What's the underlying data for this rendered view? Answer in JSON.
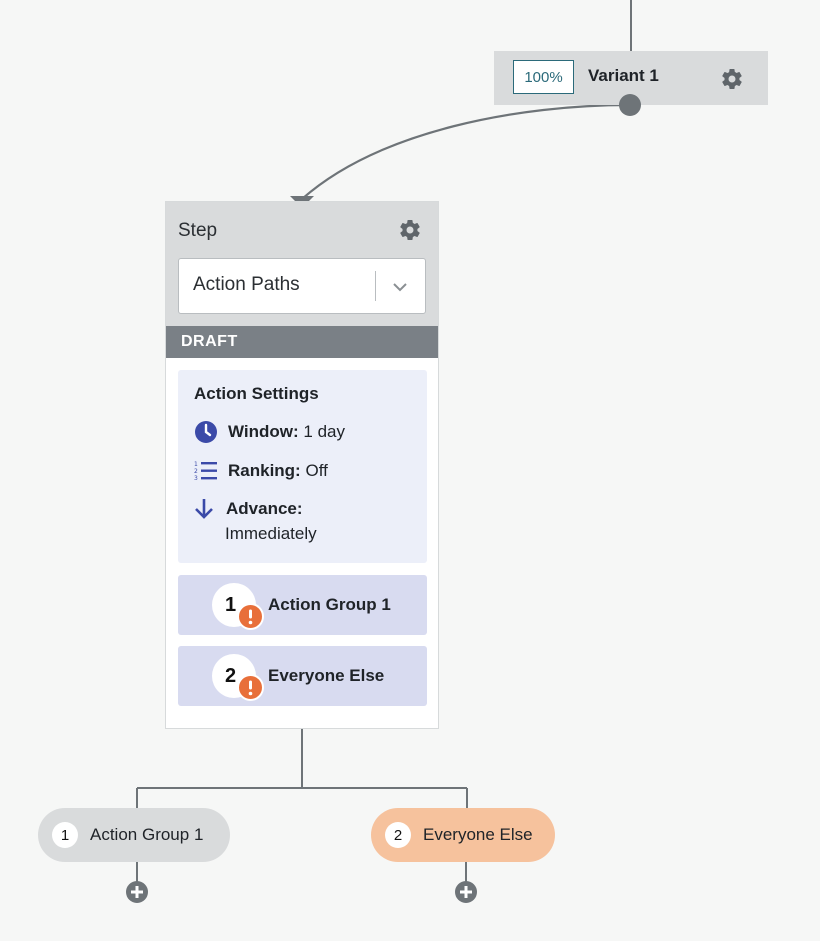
{
  "variant": {
    "percent": "100%",
    "name": "Variant 1"
  },
  "step": {
    "title": "Step",
    "select_value": "Action Paths",
    "status": "DRAFT"
  },
  "action_settings": {
    "heading": "Action Settings",
    "window_label": "Window:",
    "window_value": "1 day",
    "ranking_label": "Ranking:",
    "ranking_value": "Off",
    "advance_label": "Advance:",
    "advance_value": "Immediately"
  },
  "groups": [
    {
      "number": "1",
      "label": "Action Group 1"
    },
    {
      "number": "2",
      "label": "Everyone Else"
    }
  ],
  "paths": [
    {
      "number": "1",
      "label": "Action Group 1"
    },
    {
      "number": "2",
      "label": "Everyone Else"
    }
  ],
  "colors": {
    "accent": "#2b6a7a",
    "icon_blue": "#3b4aa8",
    "warning": "#e86f3a",
    "path_highlight": "#f6c29d"
  },
  "icons": {
    "settings": "gear-icon",
    "dropdown": "chevron-down-icon",
    "window": "clock-icon",
    "ranking": "ranked-list-icon",
    "advance": "arrow-down-icon",
    "warning": "exclamation-icon",
    "add": "plus-icon"
  }
}
